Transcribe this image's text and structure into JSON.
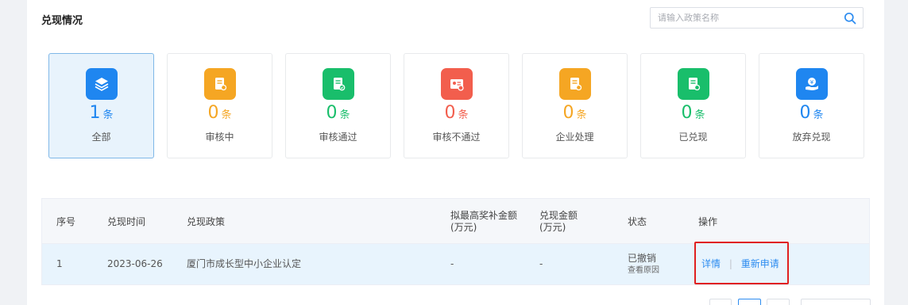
{
  "header": {
    "title": "兑现情况"
  },
  "search": {
    "placeholder": "请输入政策名称",
    "icon": "search-icon"
  },
  "colors": {
    "primary": "#2d8cf0",
    "orange": "#f5a623",
    "green": "#19be6b",
    "red": "#f25e4d",
    "blue": "#1f86f0"
  },
  "cards": [
    {
      "count": "1",
      "unit": "条",
      "label": "全部",
      "icon": "layers-icon",
      "color": "#1f86f0",
      "active": true
    },
    {
      "count": "0",
      "unit": "条",
      "label": "审核中",
      "icon": "document-review-icon",
      "color": "#f5a623"
    },
    {
      "count": "0",
      "unit": "条",
      "label": "审核通过",
      "icon": "document-approved-icon",
      "color": "#19be6b"
    },
    {
      "count": "0",
      "unit": "条",
      "label": "审核不通过",
      "icon": "document-rejected-icon",
      "color": "#f25e4d"
    },
    {
      "count": "0",
      "unit": "条",
      "label": "企业处理",
      "icon": "document-process-icon",
      "color": "#f5a623"
    },
    {
      "count": "0",
      "unit": "条",
      "label": "已兑现",
      "icon": "document-redeemed-icon",
      "color": "#19be6b"
    },
    {
      "count": "0",
      "unit": "条",
      "label": "放弃兑现",
      "icon": "hand-money-icon",
      "color": "#1f86f0"
    }
  ],
  "table": {
    "headers": {
      "index": "序号",
      "time": "兑现时间",
      "policy": "兑现政策",
      "max_amount_1": "拟最高奖补金额",
      "max_amount_2": "(万元)",
      "amount_1": "兑现金额",
      "amount_2": "(万元)",
      "status": "状态",
      "action": "操作"
    },
    "rows": [
      {
        "index": "1",
        "time": "2023-06-26",
        "policy": "厦门市成长型中小企业认定",
        "max_amount": "-",
        "amount": "-",
        "status": "已撤销",
        "status_link": "查看原因",
        "action_detail": "详情",
        "action_separator": "|",
        "action_reapply": "重新申请"
      }
    ]
  }
}
